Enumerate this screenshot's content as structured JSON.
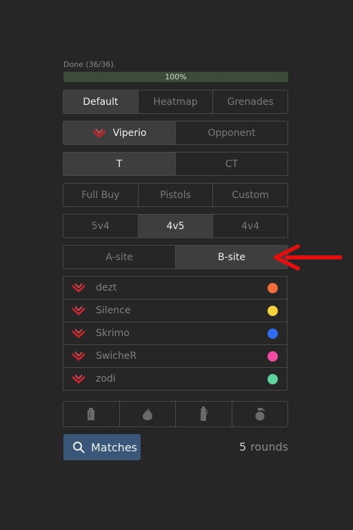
{
  "status": {
    "text": "Done (36/36).",
    "progress_fraction": 1.0,
    "progress_label": "100%"
  },
  "view_modes": {
    "options": [
      "Default",
      "Heatmap",
      "Grenades"
    ],
    "selected": "Default"
  },
  "team_selector": {
    "options": [
      "Viperio",
      "Opponent"
    ],
    "selected": "Viperio"
  },
  "side_selector": {
    "options": [
      "T",
      "CT"
    ],
    "selected": "T"
  },
  "buy_type": {
    "options": [
      "Full Buy",
      "Pistols",
      "Custom"
    ],
    "selected": null
  },
  "player_count": {
    "options": [
      "5v4",
      "4v5",
      "4v4"
    ],
    "selected": "4v5"
  },
  "site": {
    "options": [
      "A-site",
      "B-site"
    ],
    "selected": "B-site"
  },
  "players": [
    {
      "name": "dezt",
      "color": "#f26b3a"
    },
    {
      "name": "Silence",
      "color": "#f5cf3c"
    },
    {
      "name": "Skrimo",
      "color": "#2f6df0"
    },
    {
      "name": "SwicheR",
      "color": "#f04ca3"
    },
    {
      "name": "zodi",
      "color": "#5fd49a"
    }
  ],
  "utility_filters": [
    "smoke-grenade-icon",
    "molotov-icon",
    "flashbang-icon",
    "he-grenade-icon"
  ],
  "matches_button": {
    "label": "Matches",
    "icon": "search-icon"
  },
  "rounds": {
    "count": "5",
    "label": "rounds"
  },
  "colors": {
    "accent": "#3a5678",
    "team_logo": "#c0262d",
    "annotation_arrow": "#e01010"
  }
}
